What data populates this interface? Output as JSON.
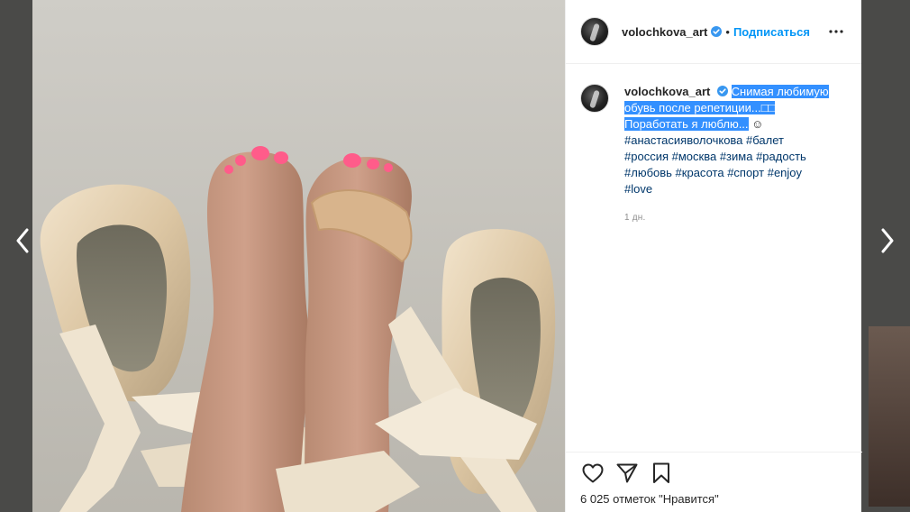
{
  "post": {
    "username": "volochkova_art",
    "follow_label": "Подписаться",
    "separator": "•",
    "caption_username": "volochkova_art",
    "caption_text_line1": "Снимая любимую",
    "caption_text_line2": "обувь после репетиции...□□",
    "caption_text_line3": "Поработать я люблю...",
    "caption_emoji": "☺",
    "hashtags": [
      "#анастасияволочкова",
      "#балет",
      "#россия",
      "#москва",
      "#зима",
      "#радость",
      "#любовь",
      "#красота",
      "#спорт",
      "#enjoy",
      "#love"
    ],
    "time_ago": "1 дн.",
    "likes_text": "6 025 отметок \"Нравится\""
  },
  "colors": {
    "accent": "#0095f6",
    "hashtag": "#00376b",
    "selection": "#3390ff",
    "nail_polish": "#ff5c8a"
  },
  "icons": {
    "prev": "chevron-left-icon",
    "next": "chevron-right-icon",
    "more": "ellipsis-icon",
    "verified": "verified-badge-icon",
    "like": "heart-icon",
    "share": "paper-plane-icon",
    "save": "bookmark-icon"
  }
}
